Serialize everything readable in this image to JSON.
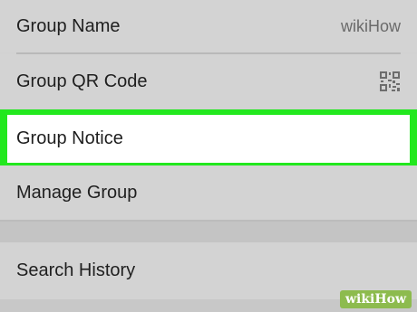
{
  "rows": {
    "group_name": {
      "label": "Group Name",
      "value": "wikiHow"
    },
    "group_qr": {
      "label": "Group QR Code",
      "icon": "qr-code-icon"
    },
    "group_notice": {
      "label": "Group Notice",
      "highlight_color": "#22e81e"
    },
    "manage_group": {
      "label": "Manage Group"
    },
    "search_history": {
      "label": "Search History"
    }
  },
  "watermark": {
    "text": "wikiHow"
  }
}
